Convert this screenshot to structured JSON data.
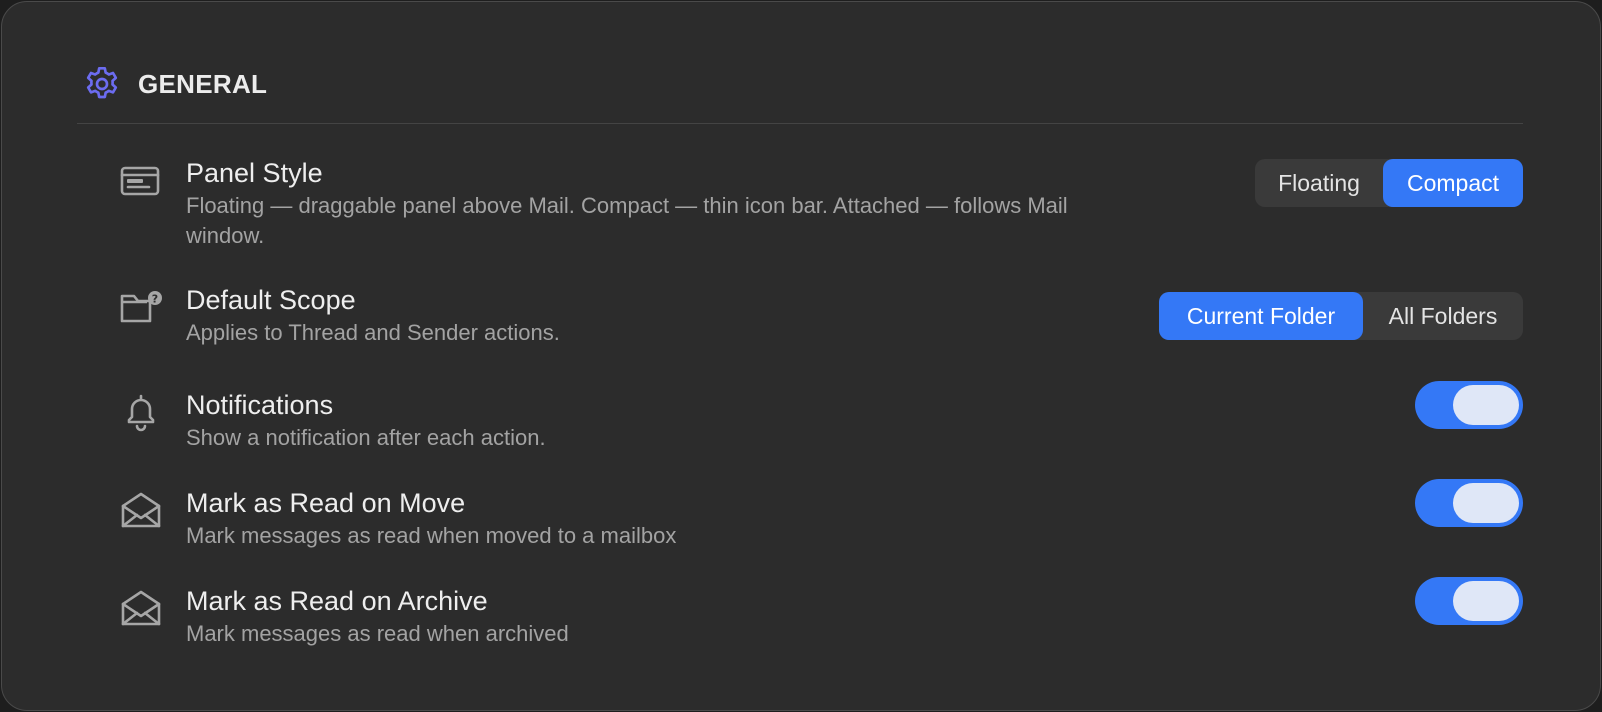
{
  "section": {
    "title": "GENERAL",
    "icon": "gear-icon",
    "accent_color": "#6c6cf0"
  },
  "settings": [
    {
      "title": "Panel Style",
      "description": "Floating — draggable panel above Mail. Compact — thin icon bar. Attached — follows Mail window.",
      "icon": "panel-icon",
      "control": "segmented",
      "options": [
        "Floating",
        "Compact"
      ],
      "selected": "Compact"
    },
    {
      "title": "Default Scope",
      "description": "Applies to Thread and Sender actions.",
      "icon": "folder-question-icon",
      "control": "segmented",
      "options": [
        "Current Folder",
        "All Folders"
      ],
      "selected": "Current Folder"
    },
    {
      "title": "Notifications",
      "description": "Show a notification after each action.",
      "icon": "bell-icon",
      "control": "toggle",
      "on": true
    },
    {
      "title": "Mark as Read on Move",
      "description": "Mark messages as read when moved to a mailbox",
      "icon": "envelope-open-icon",
      "control": "toggle",
      "on": true
    },
    {
      "title": "Mark as Read on Archive",
      "description": "Mark messages as read when archived",
      "icon": "envelope-open-icon",
      "control": "toggle",
      "on": true
    }
  ],
  "colors": {
    "background": "#2c2c2c",
    "active": "#3478f6",
    "knob": "#dfe7f7"
  }
}
